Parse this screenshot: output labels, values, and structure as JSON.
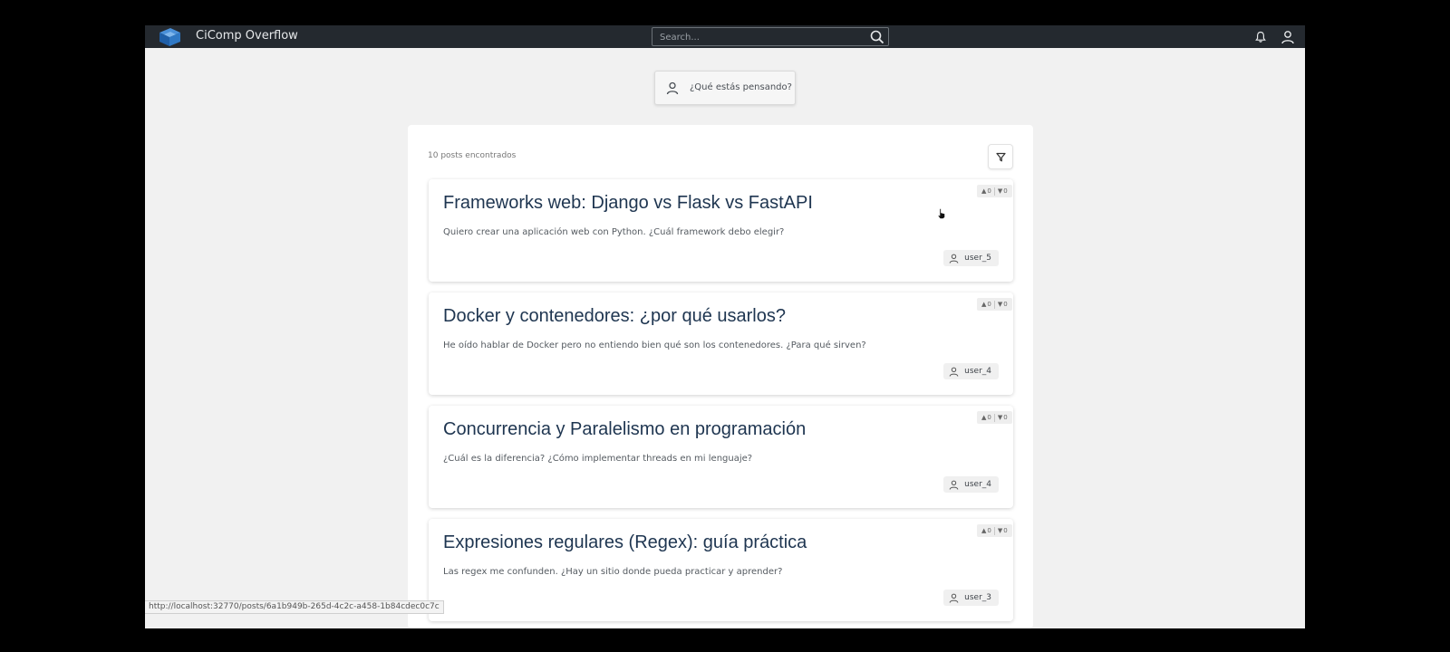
{
  "header": {
    "app_title": "CiComp Overflow",
    "search_placeholder": "Search...",
    "icons": [
      "logo-icon",
      "search-icon",
      "bell-icon",
      "user-icon"
    ]
  },
  "composer": {
    "placeholder": "¿Qué estás pensando?"
  },
  "feed": {
    "count_text": "10 posts encontrados",
    "posts": [
      {
        "title": "Frameworks web: Django vs Flask vs FastAPI",
        "body": "Quiero crear una aplicación web con Python. ¿Cuál framework debo elegir?",
        "author": "user_5",
        "upvotes": "0",
        "downvotes": "0"
      },
      {
        "title": "Docker y contenedores: ¿por qué usarlos?",
        "body": "He oído hablar de Docker pero no entiendo bien qué son los contenedores. ¿Para qué sirven?",
        "author": "user_4",
        "upvotes": "0",
        "downvotes": "0"
      },
      {
        "title": "Concurrencia y Paralelismo en programación",
        "body": "¿Cuál es la diferencia? ¿Cómo implementar threads en mi lenguaje?",
        "author": "user_4",
        "upvotes": "0",
        "downvotes": "0"
      },
      {
        "title": "Expresiones regulares (Regex): guía práctica",
        "body": "Las regex me confunden. ¿Hay un sitio donde pueda practicar y aprender?",
        "author": "user_3",
        "upvotes": "0",
        "downvotes": "0"
      }
    ]
  },
  "status_bar": {
    "url": "http://localhost:32770/posts/6a1b949b-265d-4c2c-a458-1b84cdec0c7c"
  },
  "colors": {
    "topbar": "#24292f",
    "title": "#1e3550",
    "background": "#f1f1f1"
  }
}
